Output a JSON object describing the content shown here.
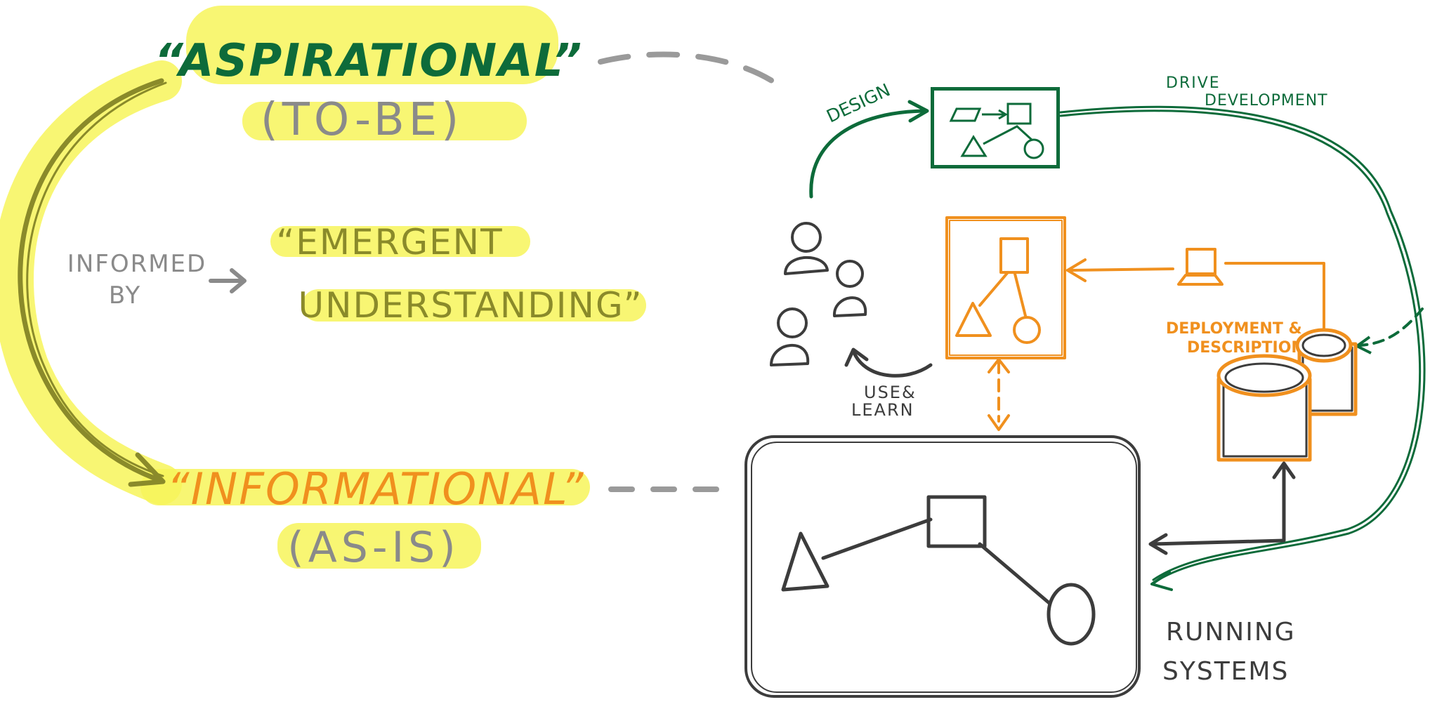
{
  "colors": {
    "highlight": "#f7f55a",
    "green": "#0d6b3a",
    "orange": "#f0901e",
    "gray": "#8a8a8a",
    "dark": "#3c3c3c"
  },
  "left": {
    "aspirational": "“ASPIRATIONAL”",
    "to_be": "(TO-BE)",
    "informed_by": [
      "INFORMED",
      "BY"
    ],
    "emergent": [
      "“EMERGENT",
      "UNDERSTANDING”"
    ],
    "informational": "“INFORMATIONAL”",
    "as_is": "(AS-IS)"
  },
  "right": {
    "design": "DESIGN",
    "drive_development": [
      "DRIVE",
      "DEVELOPMENT"
    ],
    "use_learn": [
      "USE&",
      "LEARN"
    ],
    "deployment": [
      "DEPLOYMENT &",
      "DESCRIPTION"
    ],
    "running_systems": [
      "RUNNING",
      "SYSTEMS"
    ]
  }
}
